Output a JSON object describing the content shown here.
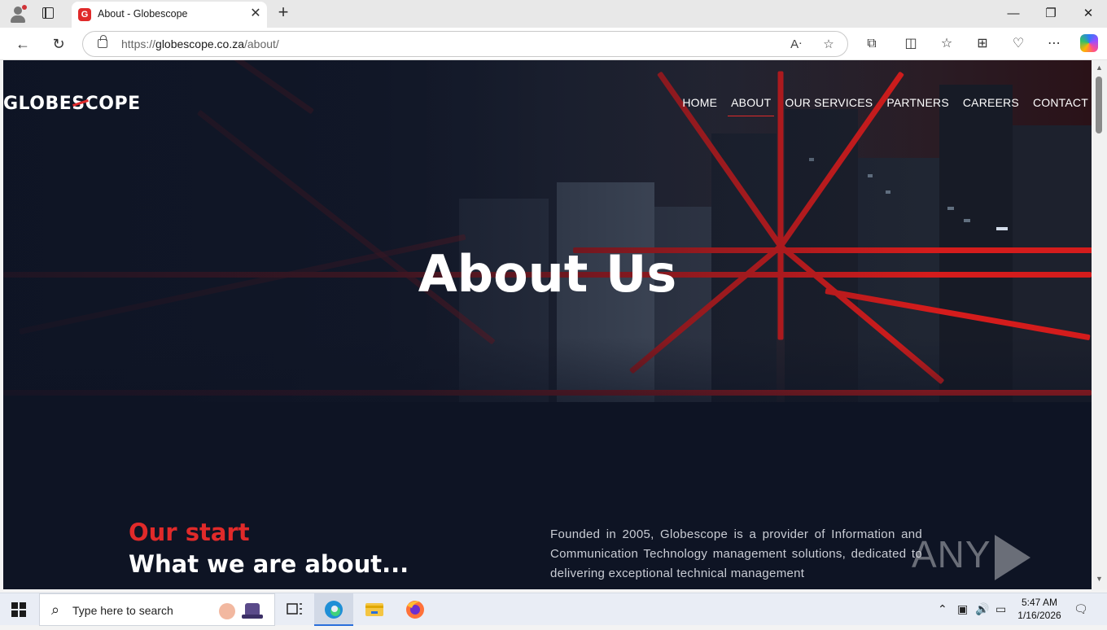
{
  "browser": {
    "tab_title": "About - Globescope",
    "favicon_letter": "G",
    "url_prefix": "https://",
    "url_host": "globescope.co.za",
    "url_path": "/about/",
    "minimize": "—",
    "maximize": "❐",
    "close": "✕"
  },
  "site": {
    "logo": {
      "part1": "GLOBE",
      "part2": "S",
      "part3": "COPE"
    },
    "nav": [
      {
        "label": "HOME"
      },
      {
        "label": "ABOUT",
        "active": true
      },
      {
        "label": "OUR SERVICES"
      },
      {
        "label": "PARTNERS"
      },
      {
        "label": "CAREERS"
      },
      {
        "label": "CONTACT"
      }
    ],
    "hero_title": "About Us",
    "kicker": "Our start",
    "section_title": "What we are about...",
    "about_text": "Founded in 2005, Globescope is a provider of Information and Communication Technology management solutions, dedicated to delivering exceptional technical management",
    "accent_color": "#e02a2a",
    "background_color": "#0e1424"
  },
  "watermark": {
    "left": "ANY",
    "right": "RUN"
  },
  "taskbar": {
    "search_placeholder": "Type here to search",
    "time": "5:47 AM",
    "date": "1/16/2026"
  }
}
